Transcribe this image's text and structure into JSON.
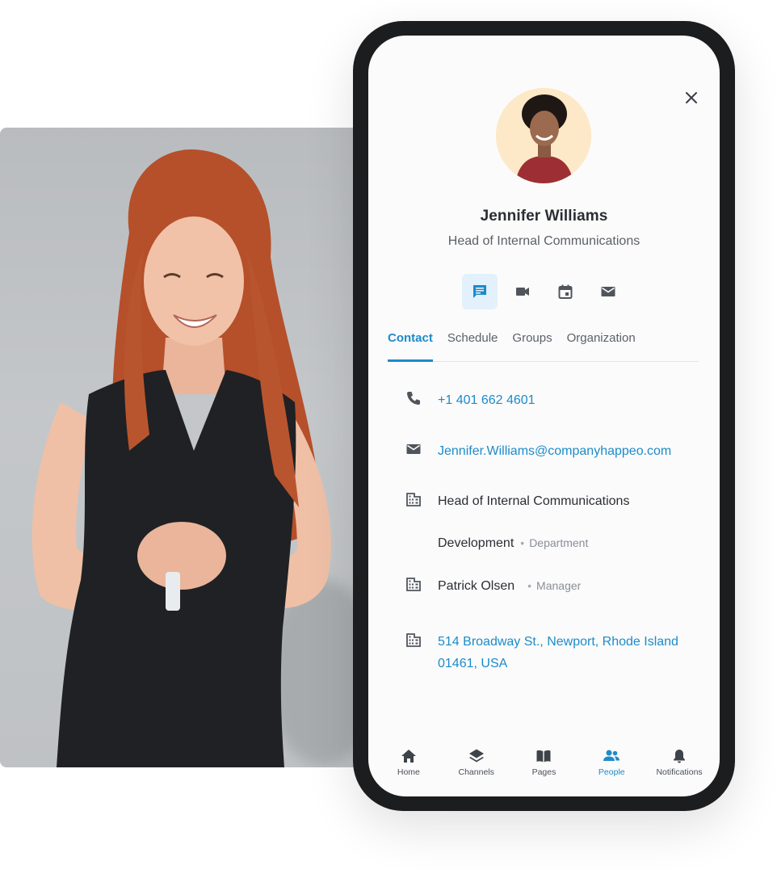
{
  "profile": {
    "name": "Jennifer Williams",
    "title": "Head of Internal Communications"
  },
  "action_icons": [
    "chat-icon",
    "video-icon",
    "calendar-icon",
    "mail-icon"
  ],
  "tabs": [
    {
      "label": "Contact",
      "active": true
    },
    {
      "label": "Schedule",
      "active": false
    },
    {
      "label": "Groups",
      "active": false
    },
    {
      "label": "Organization",
      "active": false
    }
  ],
  "contact": {
    "phone": "+1 401 662 4601",
    "email": "Jennifer.Williams@companyhappeo.com",
    "job_title": "Head of Internal Communications",
    "department": {
      "value": "Development",
      "label": "Department"
    },
    "manager": {
      "value": "Patrick Olsen",
      "label": "Manager"
    },
    "address_line1": "514 Broadway St., Newport, Rhode Island",
    "address_line2": "01461, USA"
  },
  "bottom_nav": [
    {
      "label": "Home",
      "icon": "home-icon",
      "active": false
    },
    {
      "label": "Channels",
      "icon": "layers-icon",
      "active": false
    },
    {
      "label": "Pages",
      "icon": "book-icon",
      "active": false
    },
    {
      "label": "People",
      "icon": "people-icon",
      "active": true
    },
    {
      "label": "Notifications",
      "icon": "bell-icon",
      "active": false
    }
  ],
  "colors": {
    "accent": "#1d8bc8",
    "accent_bg": "#e2f1fb",
    "phone_frame": "#1c1d1f"
  }
}
